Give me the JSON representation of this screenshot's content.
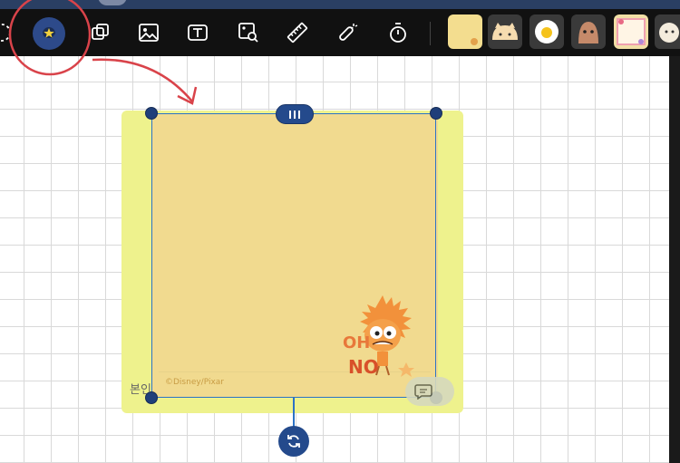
{
  "note": {
    "watermark": "©Disney/Pixar",
    "side_label": "본인",
    "character_text_1": "OH",
    "character_text_2": "NO"
  },
  "colors": {
    "toolbar_bg": "#111111",
    "active_tool": "#2d4a8a",
    "selection": "#2c73c6",
    "annotation_red": "#d9434a",
    "note_outer": "#eef28d",
    "note_inner": "#f1da8f"
  },
  "toolbar": {
    "tools": [
      "lasso-icon",
      "sticker-icon",
      "shapes-icon",
      "image-icon",
      "text-icon",
      "image-search-icon",
      "ruler-icon",
      "laser-pointer-icon",
      "timer-icon"
    ],
    "sticker_thumbnails": [
      "yellow-note-thumb",
      "cat-bun-thumb",
      "fried-egg-thumb",
      "brown-blob-thumb",
      "pink-frame-thumb",
      "sheep-thumb"
    ]
  }
}
